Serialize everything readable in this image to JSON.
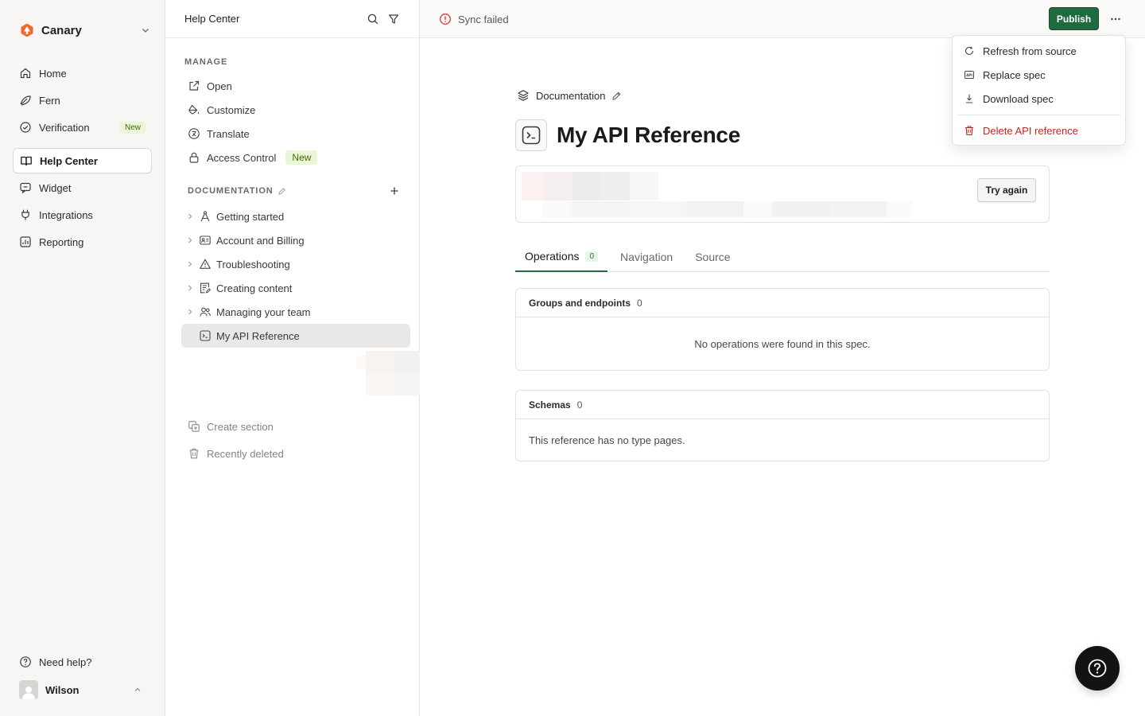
{
  "workspace": {
    "name": "Canary"
  },
  "nav": {
    "items": [
      {
        "id": "home",
        "label": "Home"
      },
      {
        "id": "fern",
        "label": "Fern"
      },
      {
        "id": "verification",
        "label": "Verification",
        "badge": "New"
      },
      {
        "id": "help-center",
        "label": "Help Center",
        "active": true
      },
      {
        "id": "widget",
        "label": "Widget"
      },
      {
        "id": "integrations",
        "label": "Integrations"
      },
      {
        "id": "reporting",
        "label": "Reporting"
      }
    ],
    "need_help": "Need help?",
    "user": "Wilson"
  },
  "panel": {
    "title": "Help Center",
    "manage_label": "MANAGE",
    "manage_items": [
      {
        "id": "open",
        "label": "Open"
      },
      {
        "id": "customize",
        "label": "Customize"
      },
      {
        "id": "translate",
        "label": "Translate"
      },
      {
        "id": "access-control",
        "label": "Access Control",
        "badge": "New"
      }
    ],
    "documentation_label": "DOCUMENTATION",
    "doc_items": [
      {
        "id": "getting-started",
        "label": "Getting started"
      },
      {
        "id": "account-and-billing",
        "label": "Account and Billing"
      },
      {
        "id": "troubleshooting",
        "label": "Troubleshooting"
      },
      {
        "id": "creating-content",
        "label": "Creating content"
      },
      {
        "id": "managing-your-team",
        "label": "Managing your team"
      },
      {
        "id": "my-api-reference",
        "label": "My API Reference",
        "active": true
      }
    ],
    "create_section": "Create section",
    "recently_deleted": "Recently deleted"
  },
  "topbar": {
    "sync_status": "Sync failed",
    "publish": "Publish"
  },
  "main": {
    "breadcrumb": "Documentation",
    "title": "My API Reference",
    "try_again": "Try again",
    "tabs": [
      {
        "id": "operations",
        "label": "Operations",
        "count": "0",
        "active": true
      },
      {
        "id": "navigation",
        "label": "Navigation"
      },
      {
        "id": "source",
        "label": "Source"
      }
    ],
    "groups": {
      "label": "Groups and endpoints",
      "count": "0",
      "empty": "No operations were found in this spec."
    },
    "schemas": {
      "label": "Schemas",
      "count": "0",
      "empty": "This reference has no type pages."
    }
  },
  "menu": {
    "items": [
      {
        "id": "refresh",
        "label": "Refresh from source",
        "icon": "refresh-icon"
      },
      {
        "id": "replace",
        "label": "Replace spec",
        "icon": "api-icon"
      },
      {
        "id": "download",
        "label": "Download spec",
        "icon": "download-icon"
      }
    ],
    "danger": {
      "id": "delete",
      "label": "Delete API reference",
      "icon": "trash-icon"
    }
  },
  "colors": {
    "accent": "#1e6b3f",
    "danger": "#c0271d",
    "logo": "#f06a2b",
    "error": "#d9372b"
  }
}
